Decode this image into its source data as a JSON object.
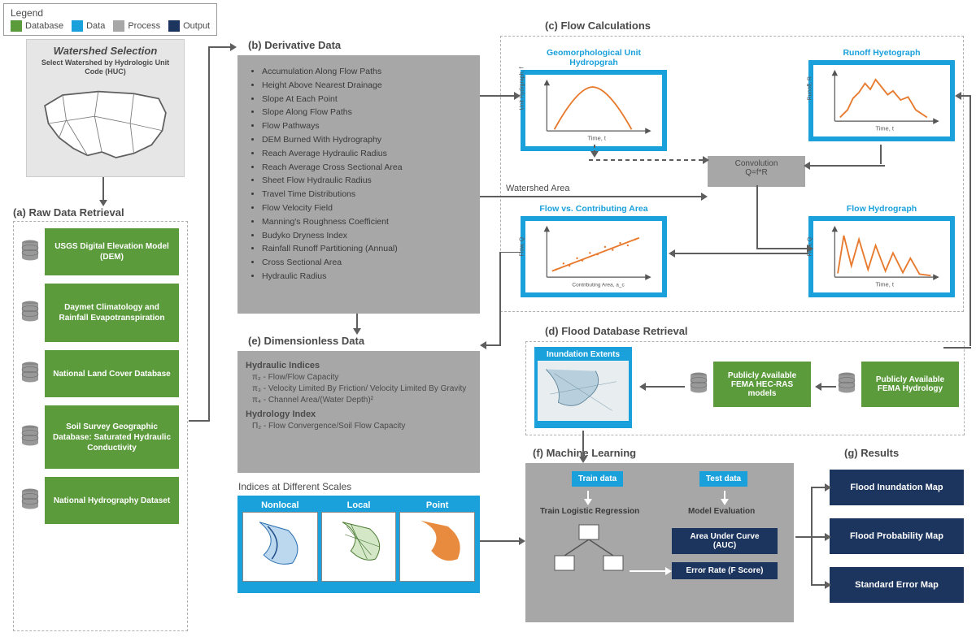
{
  "legend": {
    "title": "Legend",
    "items": [
      {
        "label": "Database",
        "color": "#5b9b3b"
      },
      {
        "label": "Data",
        "color": "#1aa0db"
      },
      {
        "label": "Process",
        "color": "#a7a7a7"
      },
      {
        "label": "Output",
        "color": "#1c355f"
      }
    ]
  },
  "watershed": {
    "title": "Watershed Selection",
    "subtitle": "Select Watershed by Hydrologic Unit Code (HUC)"
  },
  "sections": {
    "a": "(a) Raw Data Retrieval",
    "b": "(b) Derivative Data",
    "c": "(c) Flow Calculations",
    "d": "(d) Flood Database Retrieval",
    "e": "(e) Dimensionless Data",
    "f": "(f) Machine Learning",
    "g": "(g) Results"
  },
  "raw_databases": [
    "USGS Digital Elevation Model (DEM)",
    "Daymet Climatology and Rainfall Evapotranspiration",
    "National Land Cover Database",
    "Soil Survey Geographic Database: Saturated Hydraulic Conductivity",
    "National Hydrography Dataset"
  ],
  "derivative": [
    "Accumulation Along Flow Paths",
    "Height Above Nearest Drainage",
    "Slope At Each Point",
    "Slope Along Flow Paths",
    "Flow Pathways",
    "DEM Burned With Hydrography",
    "Reach Average Hydraulic Radius",
    "Reach Average Cross Sectional Area",
    "Sheet Flow Hydraulic Radius",
    "Travel Time Distributions",
    "Flow Velocity Field",
    "Manning's Roughness Coefficient",
    "Budyko Dryness Index",
    "Rainfall Runoff Partitioning (Annual)",
    "Cross Sectional Area",
    "Hydraulic Radius"
  ],
  "dimensionless": {
    "hydraulic_title": "Hydraulic Indices",
    "hydraulic": [
      "π₂ - Flow/Flow Capacity",
      "π₃ - Velocity Limited By Friction/ Velocity Limited By Gravity",
      "π₄ - Channel Area/(Water Depth)²"
    ],
    "hydrology_title": "Hydrology Index",
    "hydrology": [
      "Π₂ - Flow Convergence/Soil Flow Capacity"
    ]
  },
  "indices": {
    "title": "Indices at Different Scales",
    "labels": [
      "Nonlocal",
      "Local",
      "Point"
    ]
  },
  "flow": {
    "guh": {
      "title": "Geomorphological Unit Hydropgrah",
      "xlabel": "Time, t",
      "ylabel": "Unit Hydrgraph, f"
    },
    "runoff": {
      "title": "Runoff Hyetograph",
      "xlabel": "Time, t",
      "ylabel": "Runoff, R"
    },
    "fva": {
      "title": "Flow vs. Contributing Area",
      "xlabel": "Contributing Area, a_c",
      "ylabel": "Flow, Q"
    },
    "hydrograph": {
      "title": "Flow Hydrograph",
      "xlabel": "Time, t",
      "ylabel": "Flow, Q"
    },
    "convolution_label": "Convolution",
    "convolution_eq": "Q=f*R",
    "watershed_area": "Watershed Area"
  },
  "flood": {
    "inundation": "Inundation Extents",
    "hecras": "Publicly Available FEMA HEC-RAS models",
    "hydrology": "Publicly Available FEMA Hydrology"
  },
  "ml": {
    "train_data": "Train data",
    "test_data": "Test data",
    "train_lr": "Train Logistic Regression",
    "model_eval": "Model Evaluation",
    "auc": "Area Under Curve (AUC)",
    "err": "Error Rate (F Score)"
  },
  "results": [
    "Flood  Inundation Map",
    "Flood Probability Map",
    "Standard Error Map"
  ]
}
